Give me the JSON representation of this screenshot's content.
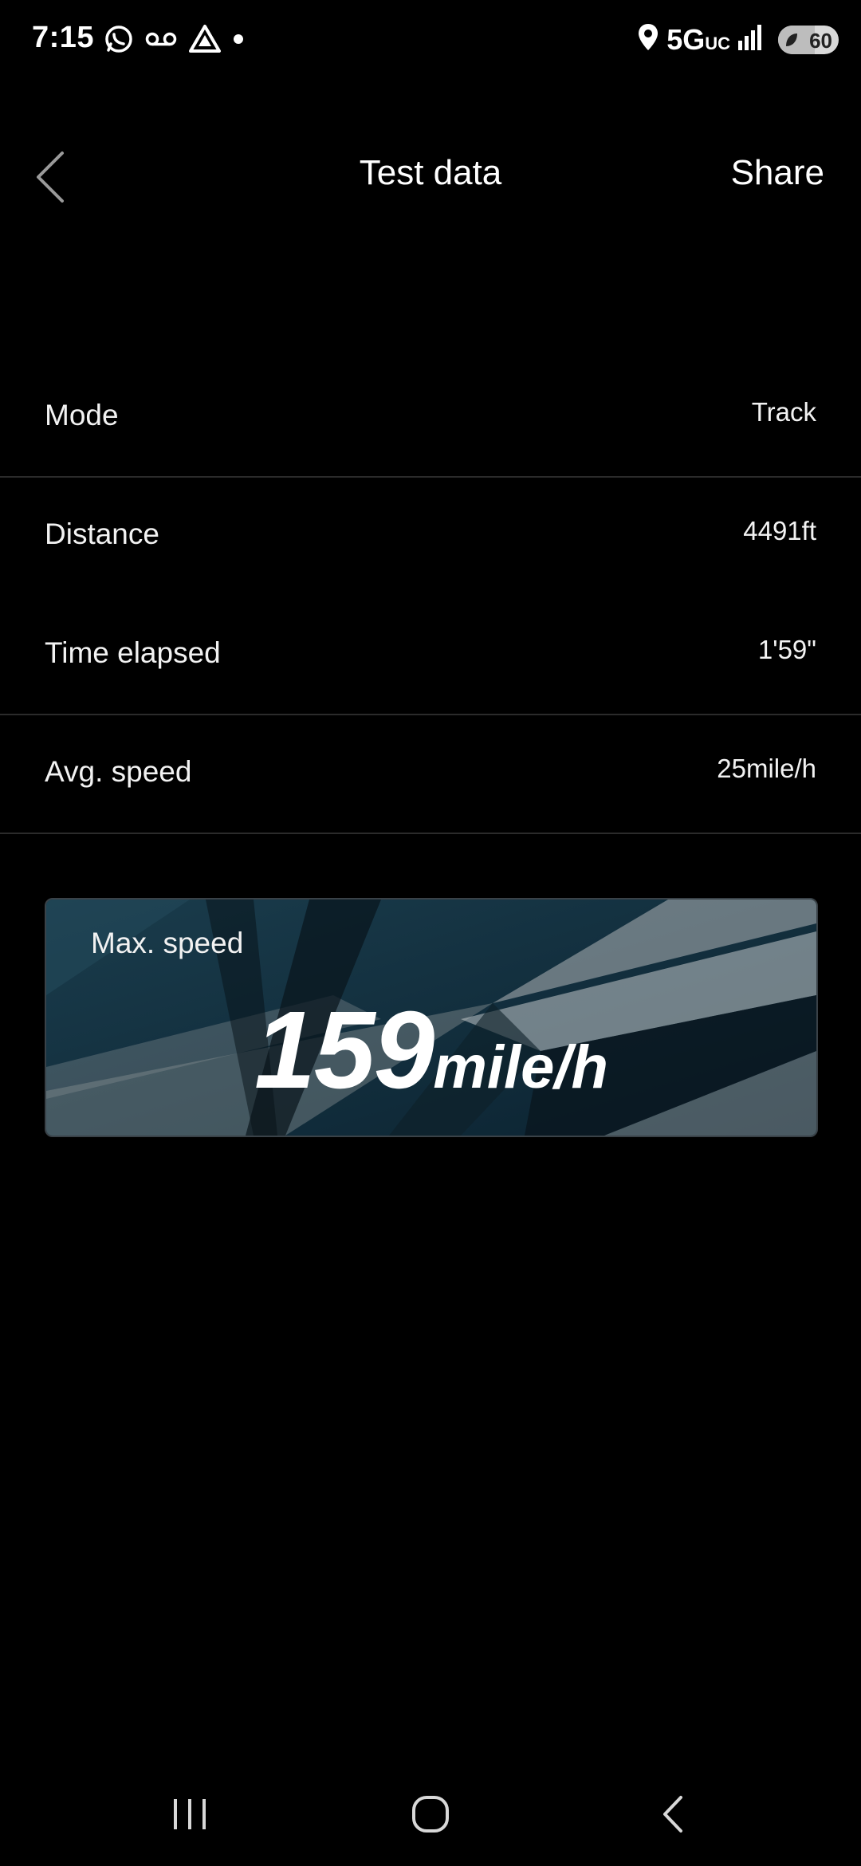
{
  "status_bar": {
    "time": "7:15",
    "network": "5G",
    "network_sub": "UC",
    "battery_level": "60",
    "icons": [
      "whatsapp-icon",
      "voicemail-icon",
      "drive-icon",
      "dot-icon",
      "location-icon",
      "signal-icon",
      "battery-icon"
    ]
  },
  "header": {
    "title": "Test data",
    "share_label": "Share",
    "back_icon": "chevron-left-icon"
  },
  "rows": [
    {
      "label": "Mode",
      "value": "Track"
    },
    {
      "label": "Distance",
      "value": "4491ft"
    },
    {
      "label": "Time elapsed",
      "value": "1'59\""
    },
    {
      "label": "Avg. speed",
      "value": "25mile/h"
    }
  ],
  "max_speed": {
    "label": "Max. speed",
    "value": "159",
    "unit": "mile/h"
  },
  "nav_bar": {
    "icons": [
      "recents-icon",
      "home-icon",
      "back-icon"
    ]
  },
  "colors": {
    "background": "#000000",
    "card": "#0f2a36",
    "divider": "#2b2b2b"
  }
}
